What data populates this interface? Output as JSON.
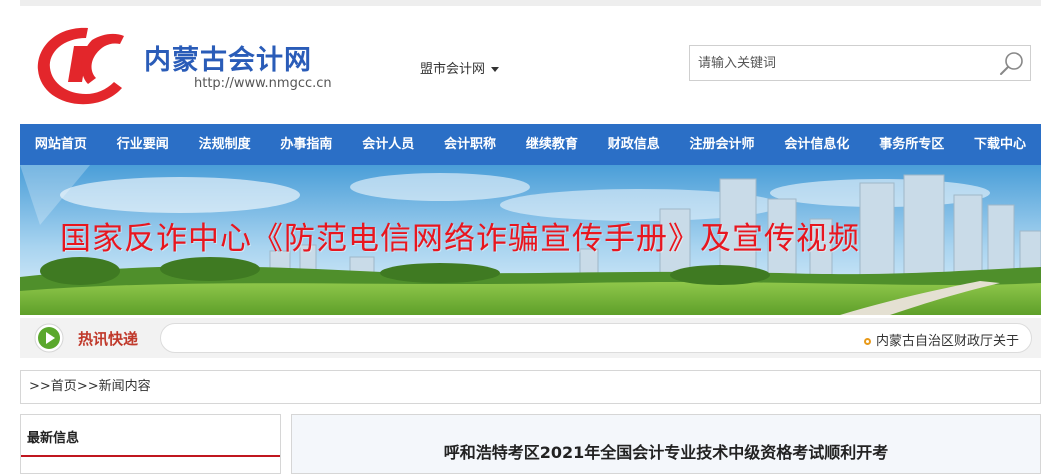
{
  "header": {
    "site_name": "内蒙古会计网",
    "site_url": "http://www.nmgcc.cn",
    "city_select_label": "盟市会计网",
    "search_placeholder": "请输入关键词"
  },
  "nav": {
    "items": [
      "网站首页",
      "行业要闻",
      "法规制度",
      "办事指南",
      "会计人员",
      "会计职称",
      "继续教育",
      "财政信息",
      "注册会计师",
      "会计信息化",
      "事务所专区",
      "下载中心"
    ]
  },
  "banner": {
    "text": "国家反诈中心《防范电信网络诈骗宣传手册》及宣传视频"
  },
  "ticker": {
    "label": "热讯快递",
    "item": "内蒙古自治区财政厅关于"
  },
  "breadcrumb": {
    "prefix": ">>",
    "home": "首页",
    "separator": ">>",
    "current": "新闻内容"
  },
  "sidebar": {
    "title": "最新信息"
  },
  "article": {
    "headline": "呼和浩特考区2021年全国会计专业技术中级资格考试顺利开考"
  },
  "colors": {
    "nav_bg": "#2b6fc6",
    "brand_blue": "#2a5cb8",
    "logo_red": "#e3262b",
    "banner_text": "#e8161f",
    "ticker_dot": "#e89a1a"
  },
  "icons": {
    "logo": "nmgcc-logo-icon",
    "search": "search-icon",
    "dropdown": "caret-down-icon",
    "ticker": "play-circle-icon"
  }
}
